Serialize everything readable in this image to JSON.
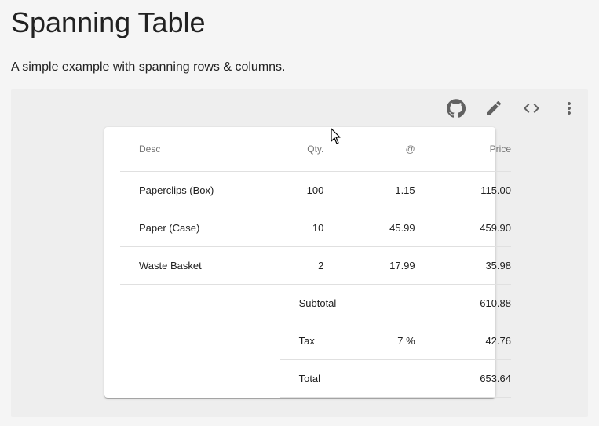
{
  "page": {
    "title": "Spanning Table",
    "description": "A simple example with spanning rows & columns."
  },
  "toolbar": {
    "icons": [
      "github-icon",
      "edit-icon",
      "code-icon",
      "more-vert-icon"
    ]
  },
  "table": {
    "headers": {
      "desc": "Desc",
      "qty": "Qty.",
      "at": "@",
      "price": "Price"
    },
    "rows": [
      {
        "desc": "Paperclips (Box)",
        "qty": "100",
        "at": "1.15",
        "price": "115.00"
      },
      {
        "desc": "Paper (Case)",
        "qty": "10",
        "at": "45.99",
        "price": "459.90"
      },
      {
        "desc": "Waste Basket",
        "qty": "2",
        "at": "17.99",
        "price": "35.98"
      }
    ],
    "subtotal": {
      "label": "Subtotal",
      "value": "610.88"
    },
    "tax": {
      "label": "Tax",
      "rate": "7 %",
      "value": "42.76"
    },
    "total": {
      "label": "Total",
      "value": "653.64"
    }
  }
}
